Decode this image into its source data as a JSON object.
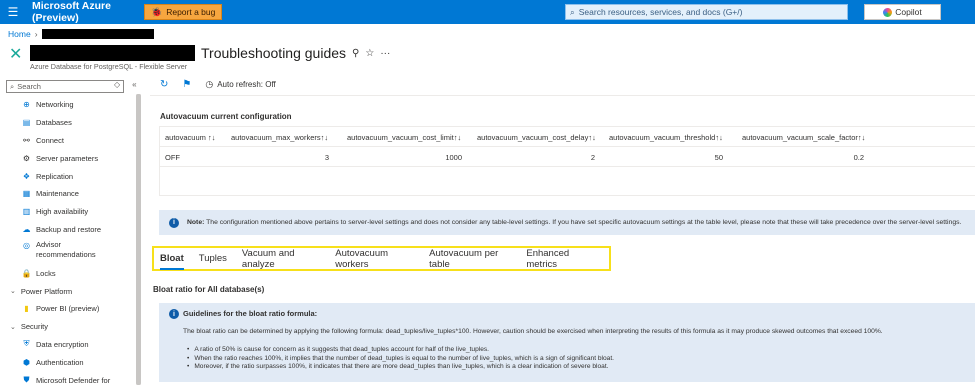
{
  "topbar": {
    "brand": "Microsoft Azure (Preview)",
    "report_bug": "Report a bug",
    "search_placeholder": "Search resources, services, and docs (G+/)",
    "copilot": "Copilot"
  },
  "breadcrumb": {
    "home": "Home"
  },
  "header": {
    "title": "Troubleshooting guides",
    "subtitle": "Azure Database for PostgreSQL - Flexible Server"
  },
  "sidebar": {
    "search_placeholder": "Search",
    "items": [
      {
        "label": "Networking",
        "icon": "network-icon"
      },
      {
        "label": "Databases",
        "icon": "database-icon"
      },
      {
        "label": "Connect",
        "icon": "connect-icon"
      },
      {
        "label": "Server parameters",
        "icon": "gear-icon"
      },
      {
        "label": "Replication",
        "icon": "replication-icon"
      },
      {
        "label": "Maintenance",
        "icon": "maintenance-icon"
      },
      {
        "label": "High availability",
        "icon": "availability-icon"
      },
      {
        "label": "Backup and restore",
        "icon": "backup-icon"
      },
      {
        "label": "Advisor recommendations",
        "icon": "advisor-icon"
      },
      {
        "label": "Locks",
        "icon": "lock-icon"
      }
    ],
    "group_power_platform": "Power Platform",
    "power_bi": "Power BI (preview)",
    "group_security": "Security",
    "data_encryption": "Data encryption",
    "authentication": "Authentication",
    "defender": "Microsoft Defender for"
  },
  "commandbar": {
    "auto_refresh": "Auto refresh: Off"
  },
  "autovacuum": {
    "title": "Autovacuum current configuration",
    "columns": [
      "autovacuum",
      "autovacuum_max_workers",
      "autovacuum_vacuum_cost_limit",
      "autovacuum_vacuum_cost_delay",
      "autovacuum_vacuum_threshold",
      "autovacuum_vacuum_scale_factor"
    ],
    "sort_glyph": "↑↓",
    "row": [
      "OFF",
      "3",
      "1000",
      "2",
      "50",
      "0.2"
    ]
  },
  "note": {
    "label": "Note:",
    "text": "The configuration mentioned above pertains to server-level settings and does not consider any table-level settings. If you have set specific autovacuum settings at the table level, please note that these will take precedence over the server-level settings."
  },
  "tabs": [
    "Bloat",
    "Tuples",
    "Vacuum and analyze",
    "Autovacuum workers",
    "Autovacuum per table",
    "Enhanced metrics"
  ],
  "bloat": {
    "title": "Bloat ratio for All database(s)",
    "guide_title": "Guidelines for the bloat ratio formula:",
    "guide_text": "The bloat ratio can be determined by applying the following formula: dead_tuples/live_tuples*100. However, caution should be exercised when interpreting the results of this formula as it may produce skewed outcomes that exceed 100%.",
    "bullets": [
      "A ratio of 50% is cause for concern as it suggests that dead_tuples account for half of the live_tuples.",
      "When the ratio reaches 100%, it implies that the number of dead_tuples is equal to the number of live_tuples, which is a sign of significant bloat.",
      "Moreover, if the ratio surpasses 100%, it indicates that there are more dead_tuples than live_tuples, which is a clear indication of severe bloat."
    ]
  }
}
